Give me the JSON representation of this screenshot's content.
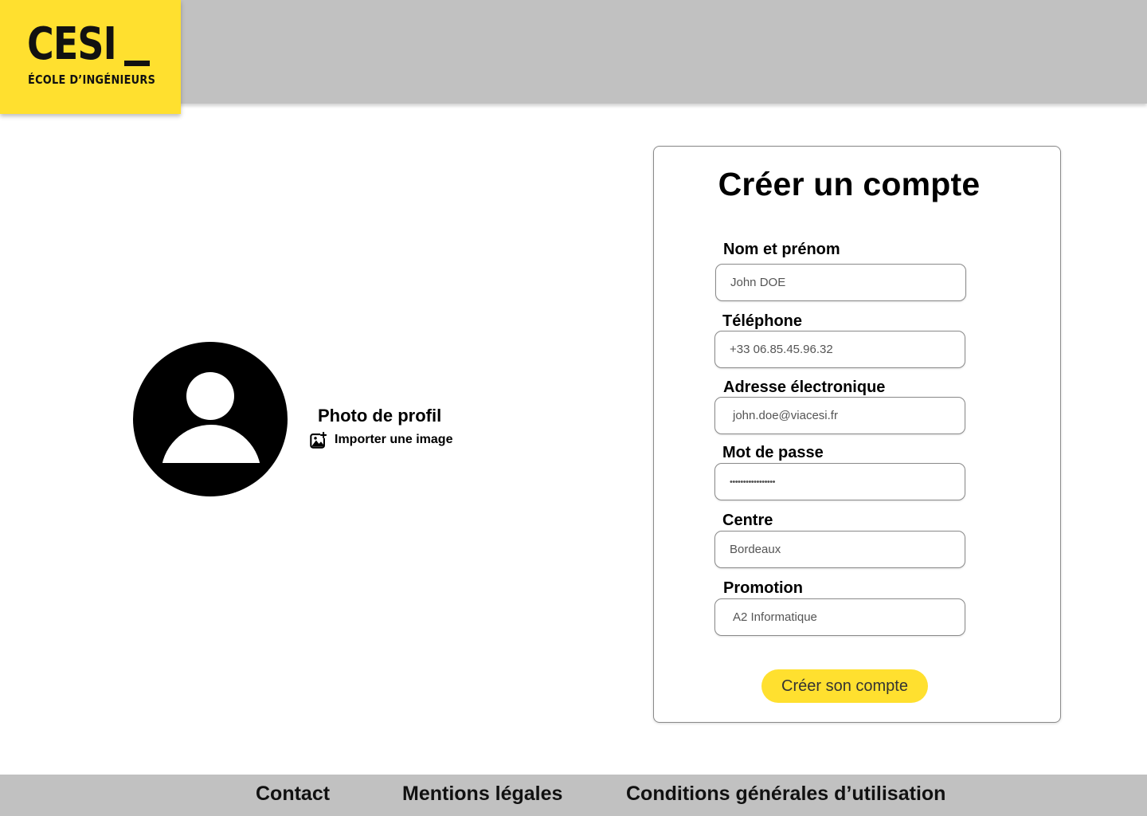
{
  "brand": {
    "name": "CESI",
    "tagline": "ÉCOLE D’INGÉNIEURS",
    "accent_color": "#ffe02f",
    "header_color": "#c1c1c1"
  },
  "profile": {
    "avatar_icon": "user-silhouette-icon",
    "title": "Photo de profil",
    "import_icon": "image-add-icon",
    "import_label": "Importer une image"
  },
  "form": {
    "title": "Créer un compte",
    "fields": [
      {
        "label": "Nom et prénom",
        "value": "John DOE"
      },
      {
        "label": "Téléphone",
        "value": "+33 06.85.45.96.32"
      },
      {
        "label": "Adresse électronique",
        "value": "john.doe@viacesi.fr"
      },
      {
        "label": "Mot de passe",
        "value": "•••••••••••••••••"
      },
      {
        "label": "Centre",
        "value": "Bordeaux"
      },
      {
        "label": "Promotion",
        "value": "A2 Informatique"
      }
    ],
    "submit_label": "Créer son compte"
  },
  "footer": {
    "links": [
      {
        "label": "Contact"
      },
      {
        "label": "Mentions légales"
      },
      {
        "label": "Conditions générales d’utilisation"
      }
    ]
  }
}
